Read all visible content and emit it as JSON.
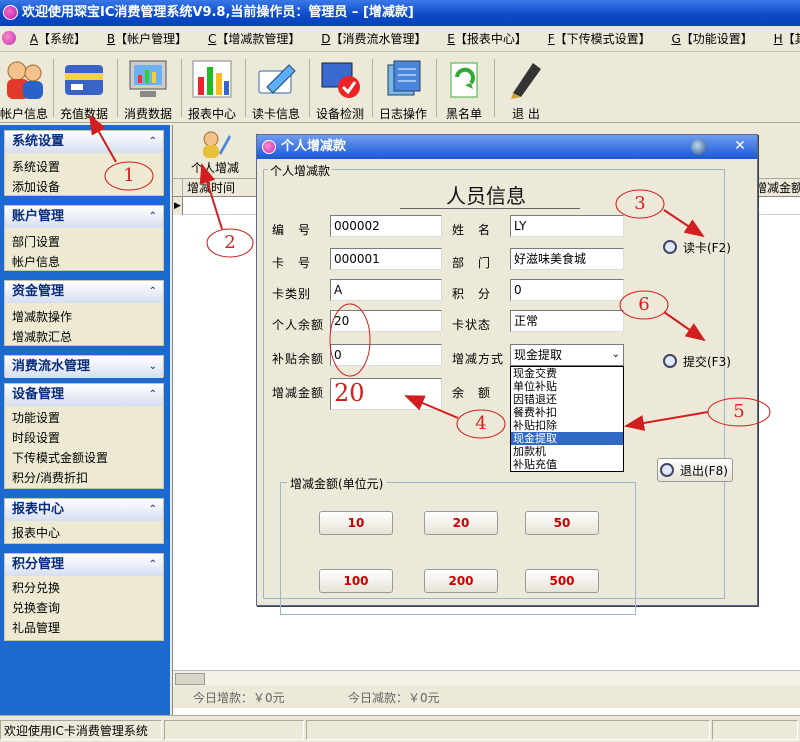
{
  "app": {
    "title": "欢迎使用琛宝IC消费管理系统V9.8,当前操作员：管理员 – [增减款]"
  },
  "menu": [
    {
      "key": "A",
      "label": "【系统】"
    },
    {
      "key": "B",
      "label": "【帐户管理】"
    },
    {
      "key": "C",
      "label": "【增减款管理】"
    },
    {
      "key": "D",
      "label": "【消费流水管理】"
    },
    {
      "key": "E",
      "label": "【报表中心】"
    },
    {
      "key": "F",
      "label": "【下传模式设置】"
    },
    {
      "key": "G",
      "label": "【功能设置】"
    },
    {
      "key": "H",
      "label": "【其他工具】"
    }
  ],
  "toolbar": [
    {
      "label": "帐户信息",
      "icon": "users-icon"
    },
    {
      "label": "充值数据",
      "icon": "recharge-icon"
    },
    {
      "label": "消费数据",
      "icon": "monitor-icon"
    },
    {
      "label": "报表中心",
      "icon": "bar-chart-icon"
    },
    {
      "label": "读卡信息",
      "icon": "card-read-icon"
    },
    {
      "label": "设备检测",
      "icon": "device-check-icon"
    },
    {
      "label": "日志操作",
      "icon": "log-icon"
    },
    {
      "label": "黑名单",
      "icon": "blacklist-icon"
    },
    {
      "label": "退 出",
      "icon": "pen-exit-icon"
    }
  ],
  "sidebar": [
    {
      "title": "系统设置",
      "items": [
        "系统设置",
        "添加设备"
      ]
    },
    {
      "title": "账户管理",
      "items": [
        "部门设置",
        "帐户信息"
      ]
    },
    {
      "title": "资金管理",
      "items": [
        "增减款操作",
        "增减款汇总"
      ]
    },
    {
      "title": "消费流水管理",
      "items": []
    },
    {
      "title": "设备管理",
      "items": [
        "功能设置",
        "时段设置",
        "下传模式金额设置",
        "积分/消费折扣"
      ]
    },
    {
      "title": "报表中心",
      "items": [
        "报表中心"
      ]
    },
    {
      "title": "积分管理",
      "items": [
        "积分兑换",
        "兑换查询",
        "礼品管理"
      ]
    }
  ],
  "main": {
    "toolbar_button": "个人增减",
    "grid_col_left": "增减时间",
    "grid_col_right": "增减金额",
    "today_add": "今日增款：￥0元",
    "today_sub": "今日减款：￥0元"
  },
  "status": {
    "text": "欢迎使用IC卡消费管理系统"
  },
  "dialog": {
    "title": "个人增减款",
    "section": "个人增减款",
    "info_title": "人员信息",
    "labels": {
      "id": "编　号",
      "name": "姓　名",
      "card": "卡　号",
      "dept": "部　门",
      "card_type": "卡类别",
      "points": "积　分",
      "balance": "个人余额",
      "card_status": "卡状态",
      "subsidy": "补贴余额",
      "method": "增减方式",
      "amount": "增减金额",
      "remain": "余　额"
    },
    "values": {
      "id": "000002",
      "name": "LY",
      "card": "000001",
      "dept": "好滋味美食城",
      "card_type": "A",
      "points": "0",
      "balance": "20",
      "card_status": "正常",
      "subsidy": "0",
      "method": "现金提取",
      "amount": "20"
    },
    "method_options": [
      "现金交费",
      "单位补贴",
      "因错退还",
      "餐费补扣",
      "补贴扣除",
      "现金提取",
      "加款机",
      "补贴充值"
    ],
    "method_selected_index": 5,
    "amount_group": "增减金额(单位元)",
    "quick_amounts": [
      "10",
      "20",
      "50",
      "100",
      "200",
      "500"
    ],
    "buttons": {
      "read_card": "读卡(F2)",
      "submit": "提交(F3)",
      "exit": "退出(F8)"
    }
  },
  "annotations": [
    "1",
    "2",
    "3",
    "4",
    "5",
    "6"
  ],
  "colors": {
    "title_bar": "#0a49c7",
    "sidebar_bg": "#1c6ad0",
    "annotation": "#d21e1e",
    "selected": "#316ac5"
  }
}
